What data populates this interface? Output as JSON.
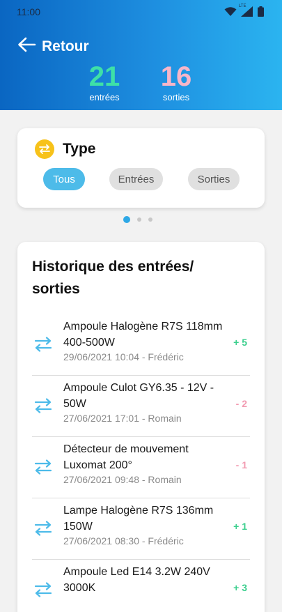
{
  "status_bar": {
    "time": "11:00",
    "network_label": "LTE"
  },
  "header": {
    "back_label": "Retour",
    "entries": {
      "count": "21",
      "label": "entrées"
    },
    "exits": {
      "count": "16",
      "label": "sorties"
    }
  },
  "type_filter": {
    "title": "Type",
    "options": [
      "Tous",
      "Entrées",
      "Sorties"
    ],
    "selected": "Tous"
  },
  "pagination": {
    "pages": 3,
    "active_index": 0
  },
  "history": {
    "title": "Historique des entrées/ sorties",
    "items": [
      {
        "name": "Ampoule Halogène R7S 118mm 400-500W",
        "meta": "29/06/2021 10:04 - Frédéric",
        "qty": "+ 5",
        "direction": "in"
      },
      {
        "name": "Ampoule Culot GY6.35 - 12V - 50W",
        "meta": "27/06/2021 17:01 - Romain",
        "qty": "- 2",
        "direction": "out"
      },
      {
        "name": "Détecteur de mouvement Luxomat 200°",
        "meta": "27/06/2021 09:48 - Romain",
        "qty": "- 1",
        "direction": "out"
      },
      {
        "name": "Lampe Halogène R7S 136mm 150W",
        "meta": "27/06/2021 08:30 - Frédéric",
        "qty": "+ 1",
        "direction": "in"
      },
      {
        "name": "Ampoule Led E14 3.2W 240V 3000K",
        "meta": "",
        "qty": "+ 3",
        "direction": "in"
      }
    ]
  },
  "colors": {
    "header_gradient_start": "#0a66c2",
    "header_gradient_end": "#2bb4f0",
    "entries_accent": "#3ee0a7",
    "exits_accent": "#f7b6c9",
    "chip_active": "#4dbbe9",
    "type_icon": "#f7c21a",
    "transfer_icon": "#4dbbe9"
  },
  "icons": {
    "back": "arrow-left-icon",
    "type": "swap-arrows-icon",
    "row": "transfer-arrows-icon",
    "status": [
      "wifi-icon",
      "signal-icon",
      "battery-icon"
    ]
  }
}
